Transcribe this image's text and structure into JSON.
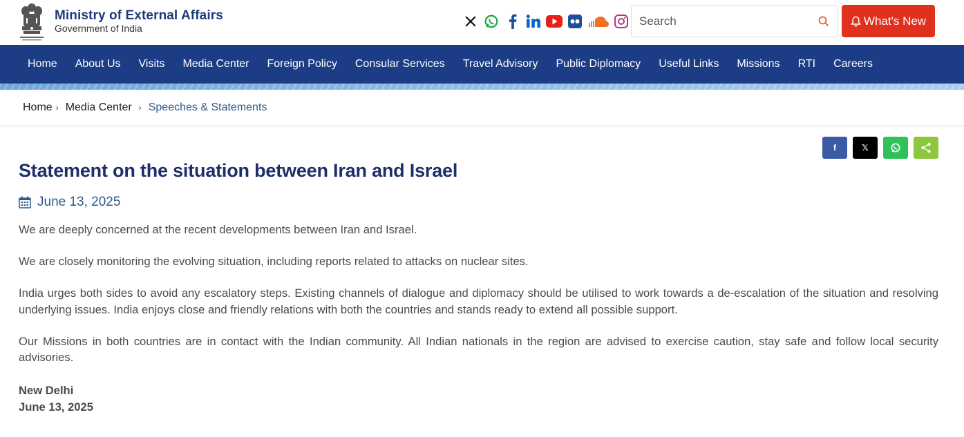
{
  "header": {
    "title": "Ministry of External Affairs",
    "subtitle": "Government of India",
    "search_placeholder": "Search",
    "whats_new_label": "What's New"
  },
  "social_icons": [
    "x-icon",
    "whatsapp-icon",
    "facebook-icon",
    "linkedin-icon",
    "youtube-icon",
    "flickr-icon",
    "soundcloud-icon",
    "instagram-icon"
  ],
  "nav": {
    "items": [
      "Home",
      "About Us",
      "Visits",
      "Media Center",
      "Foreign Policy",
      "Consular Services",
      "Travel Advisory",
      "Public Diplomacy",
      "Useful Links",
      "Missions",
      "RTI",
      "Careers"
    ]
  },
  "breadcrumb": {
    "home": "Home",
    "media_center": "Media Center",
    "current": "Speeches & Statements"
  },
  "share": {
    "facebook": "f",
    "x": "𝕏"
  },
  "article": {
    "title": "Statement on the situation between Iran and Israel",
    "date": "June 13, 2025",
    "paragraphs": [
      "We are deeply concerned at the recent developments between Iran and Israel.",
      "We are closely monitoring the evolving situation, including reports related to attacks on nuclear sites.",
      "India urges both sides to avoid any escalatory steps. Existing channels of dialogue and diplomacy should be utilised to work towards a de-escalation of the situation and resolving underlying issues. India enjoys close and friendly relations with both the countries and stands ready to extend all possible support.",
      "Our Missions in both countries are in contact with the Indian community. All Indian nationals in the region are advised to exercise caution, stay safe and follow local security advisories."
    ],
    "place": "New Delhi",
    "sign_date": "June 13, 2025"
  },
  "colors": {
    "brand_blue": "#1c3c85",
    "whats_new_red": "#e0301e",
    "title_navy": "#1c2f6b",
    "date_blue": "#2d5a8a"
  }
}
